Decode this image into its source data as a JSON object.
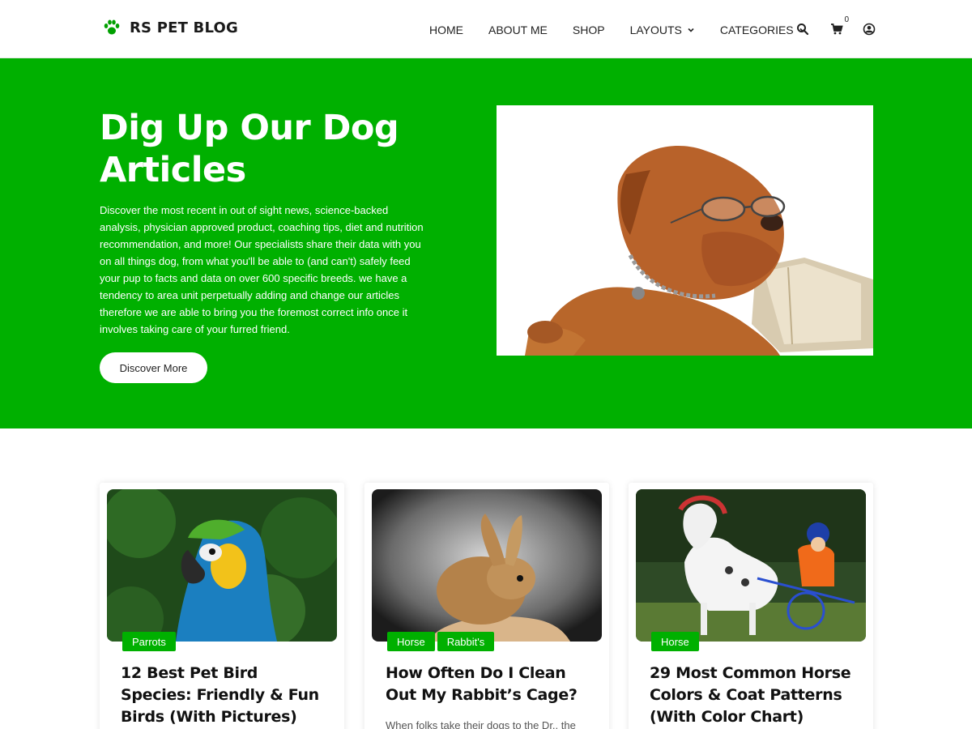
{
  "header": {
    "logo_text": "RS PET BLOG",
    "logo_icon": "paw-icon",
    "nav": [
      {
        "label": "HOME"
      },
      {
        "label": "ABOUT ME"
      },
      {
        "label": "SHOP"
      },
      {
        "label": "LAYOUTS",
        "dropdown": true
      },
      {
        "label": "CATEGORIES",
        "dropdown": true
      }
    ],
    "cart_count": "0",
    "icons": [
      "search-icon",
      "cart-icon",
      "user-icon"
    ]
  },
  "hero": {
    "title": "Dig Up Our Dog Articles",
    "text": "Discover the most recent in out of sight news, science-backed analysis, physician approved product, coaching tips, diet and nutrition recommendation, and more! Our specialists share their data with you on all things dog, from what you'll be able to (and can't) safely feed your pup to facts and data on over 600 specific breeds. we have a tendency to area unit perpetually adding and change our articles therefore we are able to bring you the foremost correct info once it involves taking care of your furred friend.",
    "button_label": "Discover More"
  },
  "cards": [
    {
      "tags": [
        "Parrots"
      ],
      "title": "12 Best Pet Bird Species: Friendly & Fun Birds (With Pictures)",
      "excerpt": ""
    },
    {
      "tags": [
        "Horse",
        "Rabbit's"
      ],
      "title": "How Often Do I Clean Out My Rabbit’s Cage?",
      "excerpt": "When folks take their dogs to the Dr., the"
    },
    {
      "tags": [
        "Horse"
      ],
      "title": "29 Most Common Horse Colors & Coat Patterns (With Color Chart)",
      "excerpt": ""
    }
  ],
  "colors": {
    "accent": "#00b000",
    "text": "#111111"
  }
}
